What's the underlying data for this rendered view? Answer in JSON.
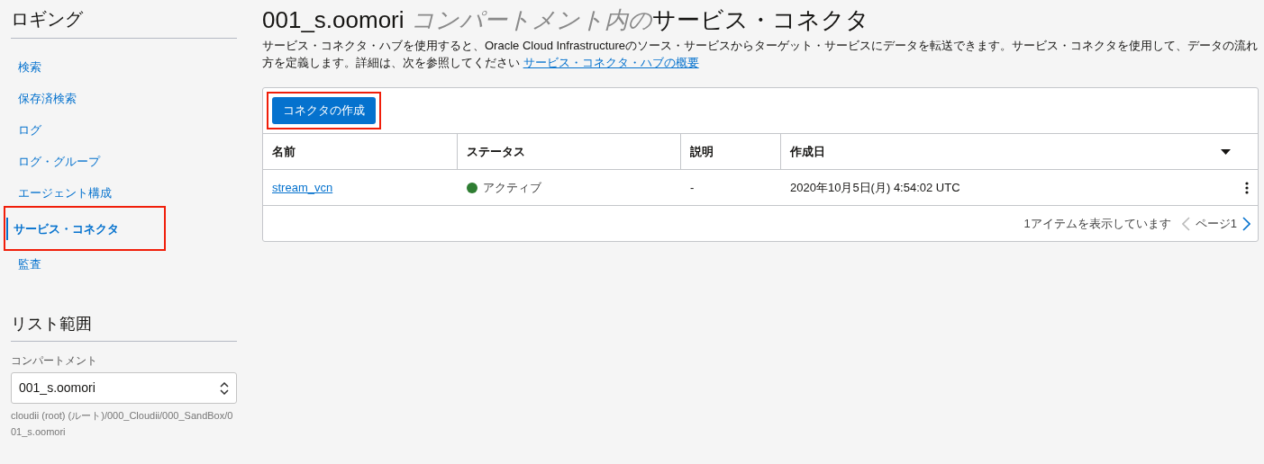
{
  "sidebar": {
    "title": "ロギング",
    "items": [
      {
        "label": "検索",
        "selected": false,
        "highlighted": false
      },
      {
        "label": "保存済検索",
        "selected": false,
        "highlighted": false
      },
      {
        "label": "ログ",
        "selected": false,
        "highlighted": false
      },
      {
        "label": "ログ・グループ",
        "selected": false,
        "highlighted": false
      },
      {
        "label": "エージェント構成",
        "selected": false,
        "highlighted": false
      },
      {
        "label": "サービス・コネクタ",
        "selected": true,
        "highlighted": true
      },
      {
        "label": "監査",
        "selected": false,
        "highlighted": false
      }
    ],
    "scope": {
      "title": "リスト範囲",
      "field_label": "コンパートメント",
      "value": "001_s.oomori",
      "path": "cloudii (root) (ルート)/000_Cloudii/000_SandBox/001_s.oomori"
    }
  },
  "page": {
    "title": {
      "compartment": "001_s.oomori",
      "qualifier": "コンパートメント内の",
      "heading": "サービス・コネクタ"
    },
    "description": "サービス・コネクタ・ハブを使用すると、Oracle Cloud Infrastructureのソース・サービスからターゲット・サービスにデータを転送できます。サービス・コネクタを使用して、データの流れ方を定義します。詳細は、次を参照してください",
    "description_link": "サービス・コネクタ・ハブの概要",
    "create_button": {
      "label": "コネクタの作成",
      "highlighted": true
    },
    "table": {
      "columns": [
        "名前",
        "ステータス",
        "説明",
        "作成日"
      ],
      "rows": [
        {
          "name": "stream_vcn",
          "status": "アクティブ",
          "color": "#2e7d32",
          "description": "-",
          "created": "2020年10月5日(月) 4:54:02 UTC"
        }
      ]
    },
    "footer": {
      "count": "1アイテムを表示しています",
      "page": "ページ1"
    }
  }
}
